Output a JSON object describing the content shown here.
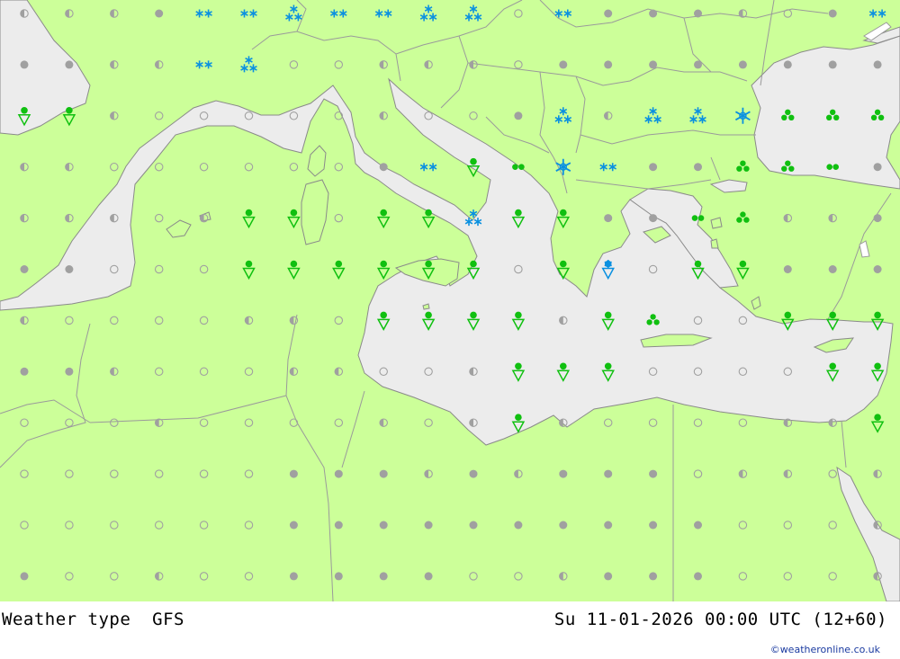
{
  "footer": {
    "left_label": "Weather type  GFS",
    "right_label": "Su 11-01-2026 00:00 UTC (12+60)",
    "credit": "©weatheronline.co.uk"
  },
  "colors": {
    "land": "#ccff99",
    "sea": "#ececec",
    "border": "#9a9a9a",
    "coast": "#8a8a8a",
    "dot_grey": "#a0a0a0",
    "rain_green": "#10c010",
    "snow_blue": "#0a90e0"
  },
  "legend_symbols": {
    "dry_full": "grey filled dot",
    "dry_half": "grey half dot",
    "dry_empty": "grey empty dot",
    "rain_shower": "green drop with triangle",
    "rain_pair": "green double dot",
    "rain_cluster": "green triple dot",
    "snow_light": "blue double asterisk",
    "snow_mod": "blue triple asterisk",
    "snow_heavy": "blue snowflake",
    "sleet_shower": "blue drop with triangle"
  },
  "grid": {
    "columns": 20,
    "rows": 12,
    "cells": [
      [
        "h",
        "h",
        "h",
        "f",
        "S",
        "S",
        "T",
        "S",
        "S",
        "T",
        "T",
        "e",
        "S",
        "f",
        "f",
        "f",
        "h",
        "e",
        "f",
        "S"
      ],
      [
        "f",
        "f",
        "h",
        "h",
        "S",
        "T",
        "e",
        "e",
        "h",
        "h",
        "h",
        "e",
        "f",
        "f",
        "f",
        "f",
        "f",
        "f",
        "f",
        "f"
      ],
      [
        "R",
        "R",
        "h",
        "e",
        "e",
        "e",
        "e",
        "e",
        "h",
        "e",
        "e",
        "f",
        "T",
        "h",
        "T",
        "T",
        "F",
        "C",
        "C",
        "C"
      ],
      [
        "h",
        "h",
        "e",
        "e",
        "e",
        "e",
        "e",
        "e",
        "f",
        "S",
        "R",
        "P",
        "F",
        "S",
        "f",
        "f",
        "C",
        "C",
        "P",
        "f"
      ],
      [
        "h",
        "h",
        "h",
        "e",
        "h",
        "R",
        "R",
        "e",
        "R",
        "R",
        "T",
        "R",
        "R",
        "f",
        "f",
        "P",
        "C",
        "h",
        "h",
        "f"
      ],
      [
        "f",
        "f",
        "e",
        "e",
        "e",
        "R",
        "R",
        "R",
        "R",
        "R",
        "R",
        "e",
        "R",
        "B",
        "e",
        "R",
        "R",
        "f",
        "f",
        "f"
      ],
      [
        "h",
        "e",
        "e",
        "e",
        "e",
        "h",
        "h",
        "e",
        "R",
        "R",
        "R",
        "R",
        "h",
        "R",
        "C",
        "e",
        "e",
        "R",
        "R",
        "R"
      ],
      [
        "f",
        "f",
        "h",
        "e",
        "e",
        "e",
        "h",
        "h",
        "e",
        "e",
        "h",
        "R",
        "R",
        "R",
        "e",
        "e",
        "e",
        "e",
        "R",
        "R"
      ],
      [
        "e",
        "e",
        "e",
        "h",
        "e",
        "e",
        "e",
        "e",
        "h",
        "e",
        "h",
        "R",
        "h",
        "e",
        "e",
        "e",
        "e",
        "h",
        "h",
        "R"
      ],
      [
        "e",
        "e",
        "e",
        "e",
        "e",
        "e",
        "f",
        "f",
        "f",
        "h",
        "f",
        "h",
        "f",
        "f",
        "f",
        "e",
        "h",
        "h",
        "e",
        "h"
      ],
      [
        "e",
        "e",
        "e",
        "e",
        "e",
        "e",
        "f",
        "f",
        "f",
        "f",
        "f",
        "f",
        "f",
        "f",
        "f",
        "f",
        "e",
        "e",
        "e",
        "h"
      ],
      [
        "f",
        "e",
        "e",
        "h",
        "e",
        "e",
        "f",
        "f",
        "f",
        "f",
        "e",
        "e",
        "h",
        "f",
        "f",
        "f",
        "e",
        "e",
        "e",
        "h"
      ]
    ]
  }
}
